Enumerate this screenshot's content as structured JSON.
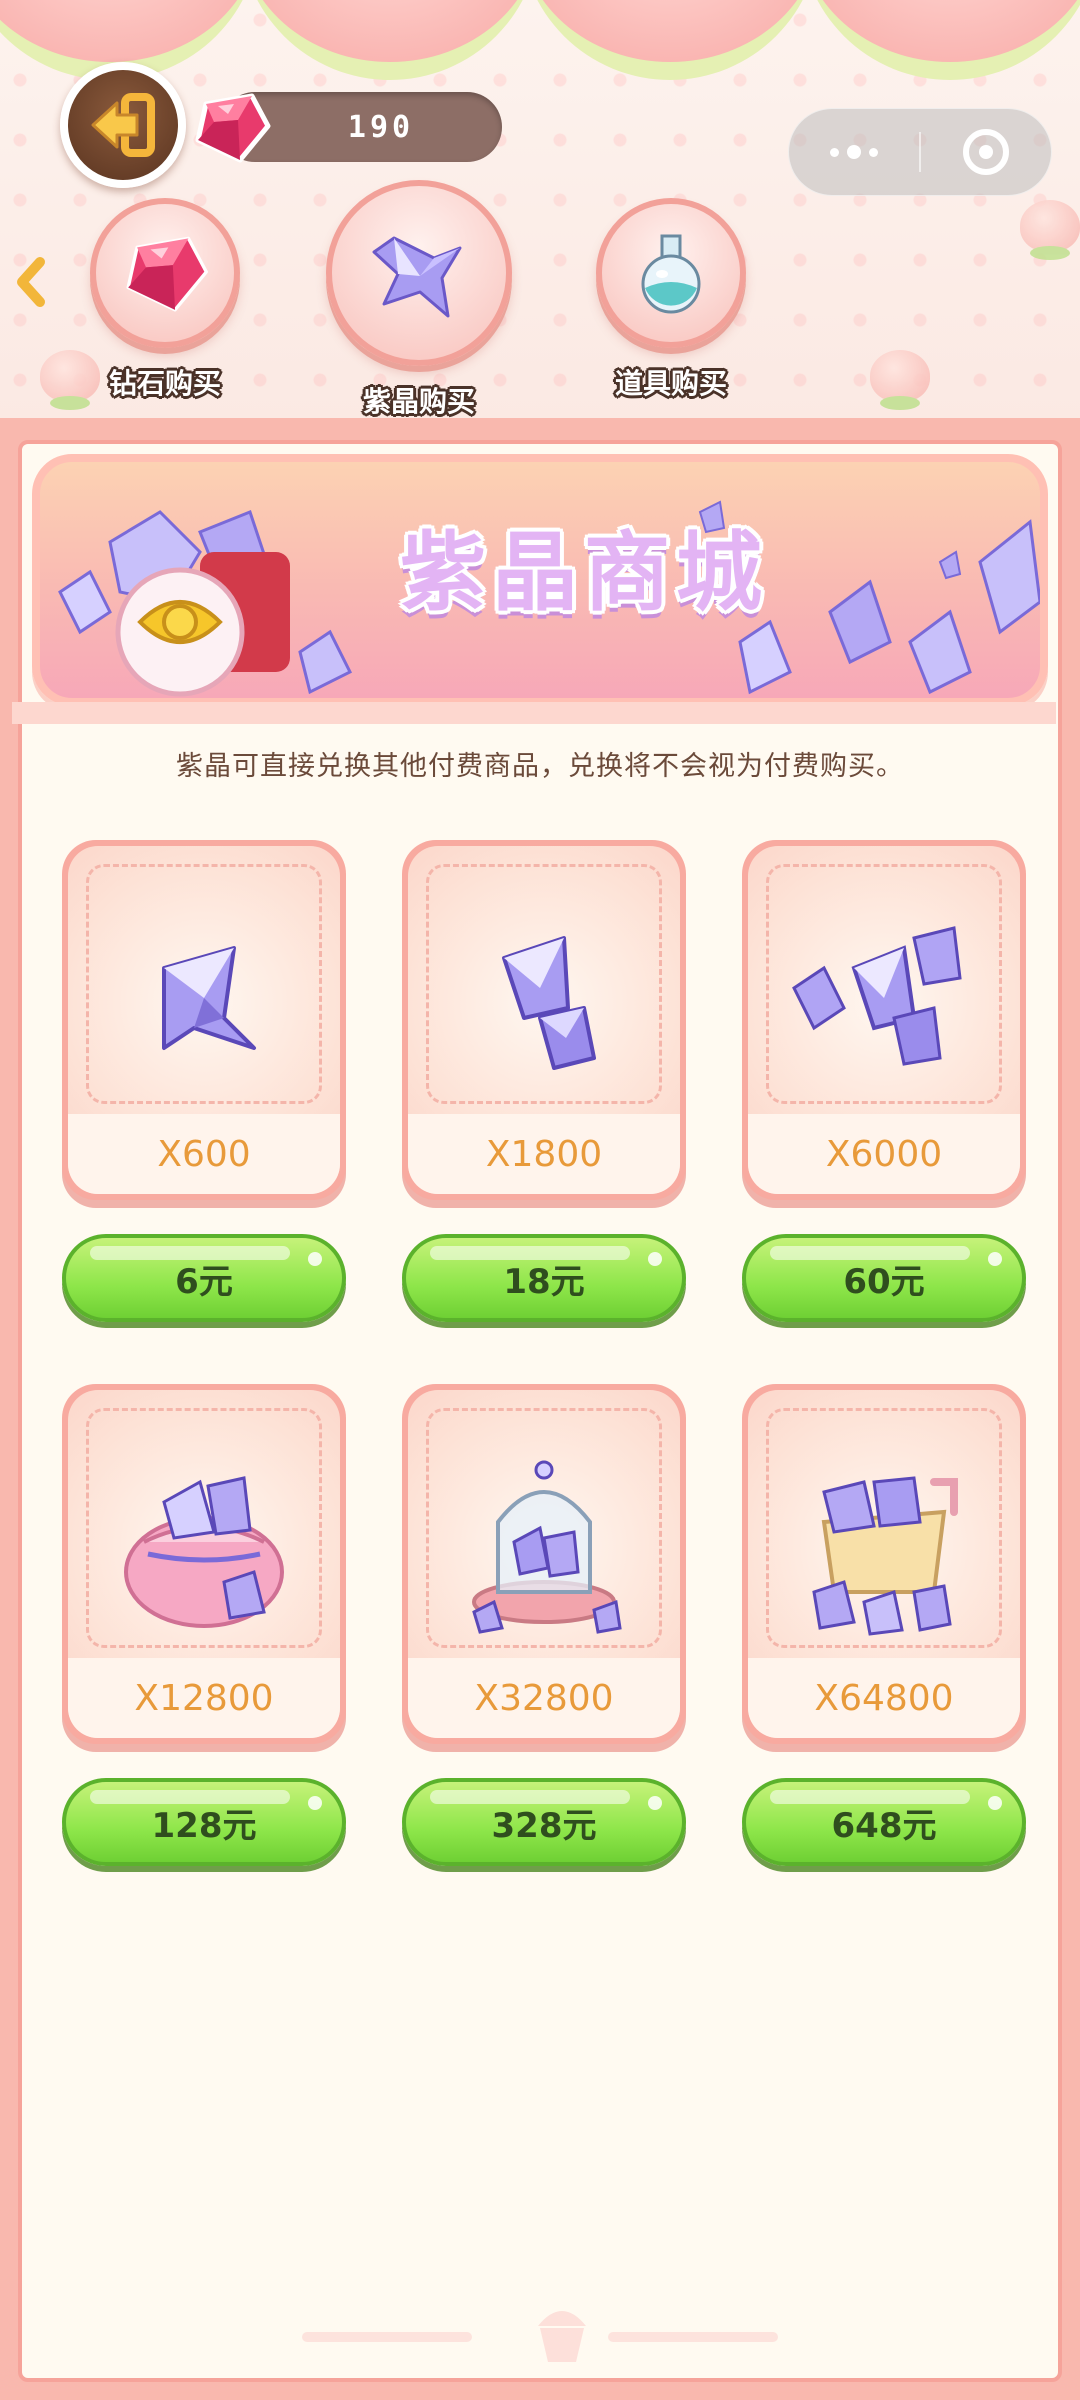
{
  "header": {
    "back_label": "",
    "gem_count": "190",
    "tabs": [
      {
        "label": "钻石购买",
        "icon": "ruby-gem-icon"
      },
      {
        "label": "紫晶购买",
        "icon": "amethyst-crystal-icon"
      },
      {
        "label": "道具购买",
        "icon": "potion-flask-icon"
      }
    ]
  },
  "banner": {
    "title": "紫晶商城"
  },
  "notice": "紫晶可直接兑换其他付费商品，兑换将不会视为付费购买。",
  "products": [
    {
      "amount": "X600",
      "price": "6元",
      "art": "single-crystal-icon"
    },
    {
      "amount": "X1800",
      "price": "18元",
      "art": "double-crystal-icon"
    },
    {
      "amount": "X6000",
      "price": "60元",
      "art": "crystal-cluster-icon"
    },
    {
      "amount": "X12800",
      "price": "128元",
      "art": "crystal-bag-icon"
    },
    {
      "amount": "X32800",
      "price": "328元",
      "art": "crystal-dome-icon"
    },
    {
      "amount": "X64800",
      "price": "648元",
      "art": "crystal-cart-icon"
    }
  ],
  "colors": {
    "accent_pink": "#f8aaa0",
    "amount_orange": "#e89a3a",
    "button_green": "#8ee64a",
    "banner_title": "#e3b4f4"
  }
}
